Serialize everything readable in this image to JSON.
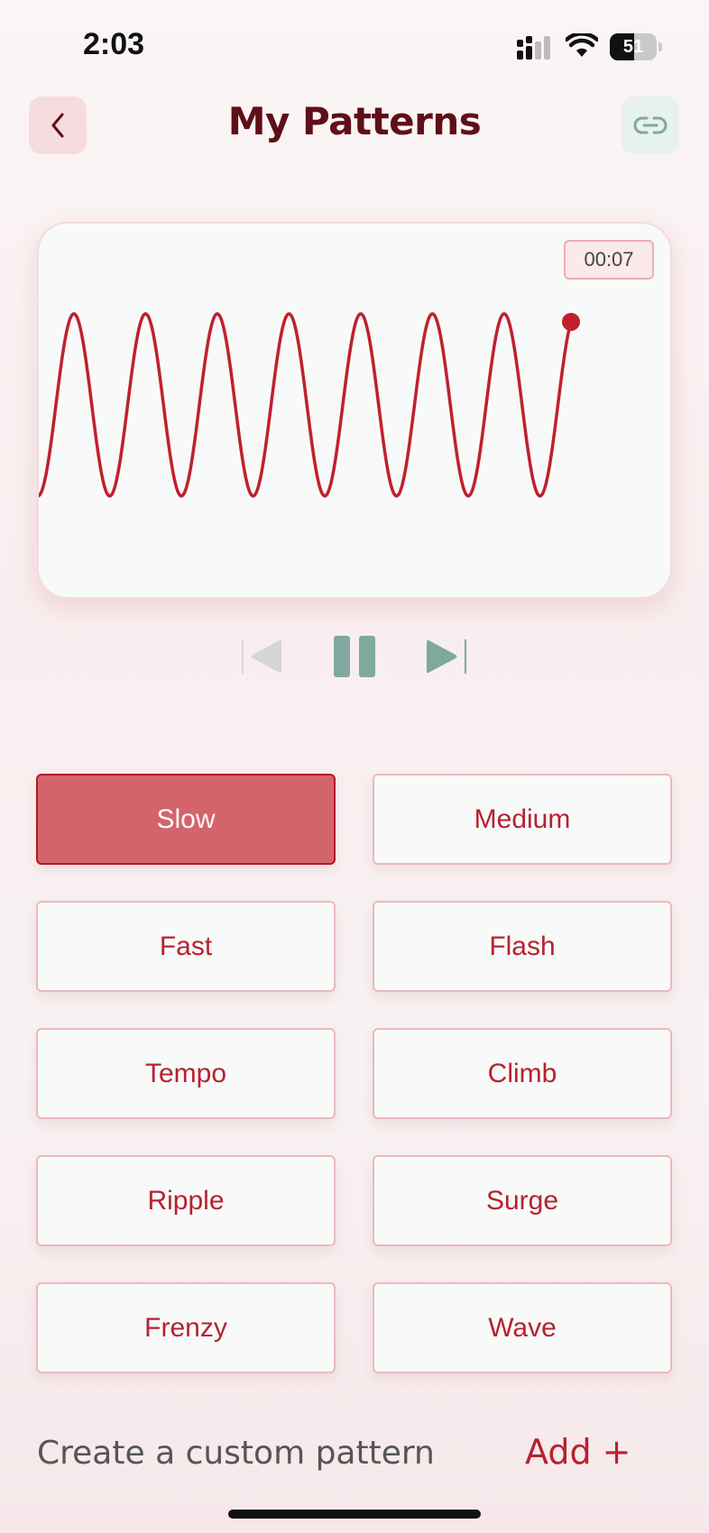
{
  "status_bar": {
    "time": "2:03",
    "battery": "51",
    "battery_level": 0.51
  },
  "header": {
    "title": "My Patterns",
    "back_icon": "chevron-left-icon",
    "link_icon": "link-icon"
  },
  "player": {
    "timer": "00:07",
    "wave_color": "#c0202e",
    "controls": {
      "prev_icon": "skip-back-icon",
      "pause_icon": "pause-icon",
      "next_icon": "skip-forward-icon"
    }
  },
  "patterns": [
    {
      "label": "Slow",
      "active": true
    },
    {
      "label": "Medium",
      "active": false
    },
    {
      "label": "Fast",
      "active": false
    },
    {
      "label": "Flash",
      "active": false
    },
    {
      "label": "Tempo",
      "active": false
    },
    {
      "label": "Climb",
      "active": false
    },
    {
      "label": "Ripple",
      "active": false
    },
    {
      "label": "Surge",
      "active": false
    },
    {
      "label": "Frenzy",
      "active": false
    },
    {
      "label": "Wave",
      "active": false
    }
  ],
  "footer": {
    "custom_label": "Create a custom pattern",
    "add_label": "Add +"
  },
  "colors": {
    "accent": "#b8212f",
    "active_bg": "#d4646b",
    "teal": "#7fa99e",
    "title": "#5e0f17"
  }
}
